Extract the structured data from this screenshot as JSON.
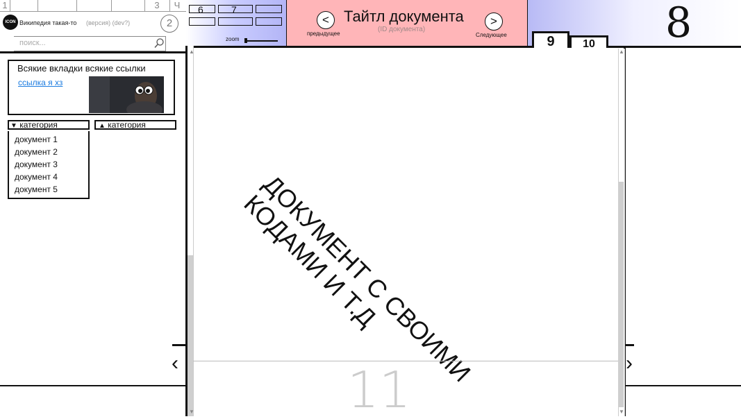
{
  "top_tabs": [
    "1",
    "",
    "",
    "",
    "",
    "3",
    "Ч"
  ],
  "sidebar": {
    "logo_text": "ICON",
    "site_title": "Википедия такая-то",
    "version": "(версия) (dev?)",
    "circle_label": "2",
    "search_placeholder": "поиск..."
  },
  "info_box": {
    "text": "Всякие вкладки всякие ссылки",
    "link": "ссылка я хз"
  },
  "categories": {
    "expanded_label": "категория",
    "collapsed_label": "категория",
    "items": [
      "документ 1",
      "документ 2",
      "документ 3",
      "документ 4",
      "документ 5"
    ]
  },
  "zoom": {
    "boxes": [
      "6",
      "7",
      "",
      "",
      "",
      ""
    ],
    "label": "zoom"
  },
  "doc_header": {
    "title": "Тайтл документа",
    "id_text": "(ID документа)",
    "prev_label": "предыдущее",
    "next_label": "Следующее",
    "prev_symbol": "<",
    "next_symbol": ">"
  },
  "corner_label": "8",
  "page_tabs": [
    "9",
    "10"
  ],
  "document": {
    "line1": "ДОКУМЕНТ С СВОИМИ",
    "line2": "КОДАМИ И Т.Д",
    "page_number": "11"
  },
  "nav_arrows": {
    "left": "‹",
    "right": "›"
  },
  "colors": {
    "header_pink": "#ffb5b8",
    "zoom_blue": "#b3b5f6",
    "link_blue": "#1a7be0"
  }
}
